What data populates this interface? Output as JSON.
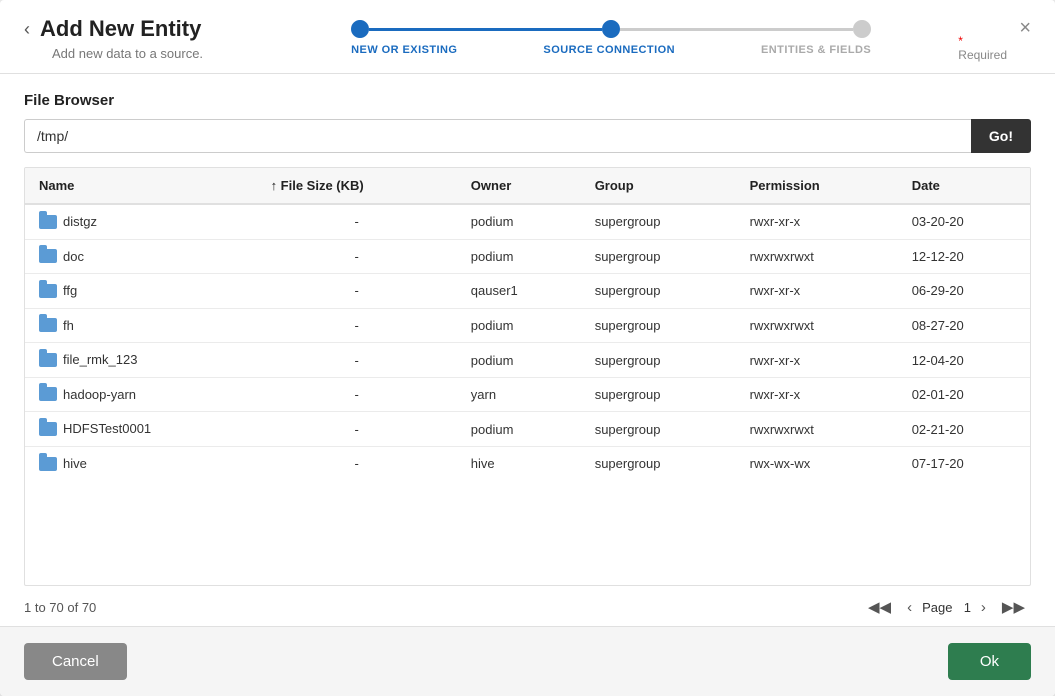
{
  "header": {
    "title": "Add New Entity",
    "subtitle": "Add new data to a source.",
    "close_label": "×",
    "back_label": "‹",
    "required_text": "Required"
  },
  "stepper": {
    "steps": [
      {
        "label": "NEW OR EXISTING",
        "state": "active"
      },
      {
        "label": "SOURCE CONNECTION",
        "state": "active"
      },
      {
        "label": "ENTITIES & FIELDS",
        "state": "inactive"
      }
    ]
  },
  "file_browser": {
    "label": "File Browser",
    "path": "/tmp/",
    "go_label": "Go!"
  },
  "table": {
    "columns": [
      {
        "key": "name",
        "label": "Name",
        "sortable": false
      },
      {
        "key": "size",
        "label": "File Size (KB)",
        "sortable": true,
        "sort_dir": "asc"
      },
      {
        "key": "owner",
        "label": "Owner",
        "sortable": false
      },
      {
        "key": "group",
        "label": "Group",
        "sortable": false
      },
      {
        "key": "permission",
        "label": "Permission",
        "sortable": false
      },
      {
        "key": "date",
        "label": "Date",
        "sortable": false
      }
    ],
    "rows": [
      {
        "name": "distgz",
        "size": "-",
        "owner": "podium",
        "group": "supergroup",
        "permission": "rwxr-xr-x",
        "date": "03-20-20"
      },
      {
        "name": "doc",
        "size": "-",
        "owner": "podium",
        "group": "supergroup",
        "permission": "rwxrwxrwxt",
        "date": "12-12-20"
      },
      {
        "name": "ffg",
        "size": "-",
        "owner": "qauser1",
        "group": "supergroup",
        "permission": "rwxr-xr-x",
        "date": "06-29-20"
      },
      {
        "name": "fh",
        "size": "-",
        "owner": "podium",
        "group": "supergroup",
        "permission": "rwxrwxrwxt",
        "date": "08-27-20"
      },
      {
        "name": "file_rmk_123",
        "size": "-",
        "owner": "podium",
        "group": "supergroup",
        "permission": "rwxr-xr-x",
        "date": "12-04-20"
      },
      {
        "name": "hadoop-yarn",
        "size": "-",
        "owner": "yarn",
        "group": "supergroup",
        "permission": "rwxr-xr-x",
        "date": "02-01-20"
      },
      {
        "name": "HDFSTest0001",
        "size": "-",
        "owner": "podium",
        "group": "supergroup",
        "permission": "rwxrwxrwxt",
        "date": "02-21-20"
      },
      {
        "name": "hive",
        "size": "-",
        "owner": "hive",
        "group": "supergroup",
        "permission": "rwx-wx-wx",
        "date": "07-17-20"
      }
    ]
  },
  "pagination": {
    "range_text": "1 to 70 of 70",
    "page_label": "Page",
    "current_page": "1"
  },
  "footer": {
    "cancel_label": "Cancel",
    "ok_label": "Ok"
  }
}
